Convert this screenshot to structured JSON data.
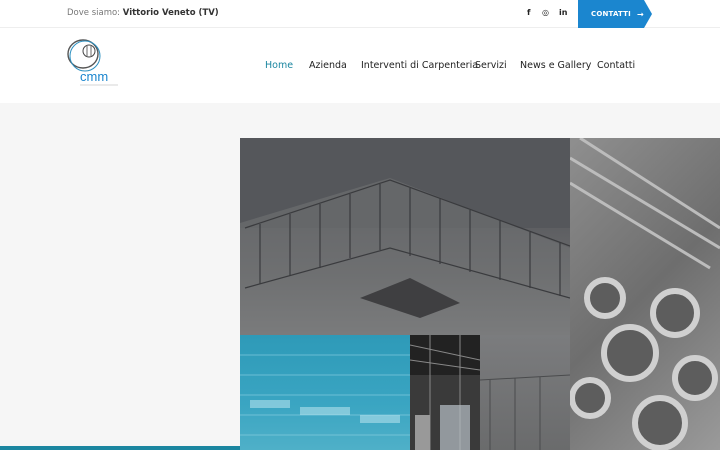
{
  "topbar": {
    "location_label": "Dove siamo:",
    "location_value": "Vittorio Veneto (TV)",
    "social": [
      "f",
      "◎",
      "in"
    ],
    "contact_label": "CONTATTI",
    "contact_arrow": "→"
  },
  "brand": {
    "logo_text": "cmm"
  },
  "nav": {
    "items": [
      "Home",
      "Azienda",
      "Interventi di Carpenteria",
      "Servizi",
      "News e Gallery",
      "Contatti"
    ],
    "active": "Home"
  },
  "colors": {
    "accent": "#1b86cf",
    "nav_active": "#1b86a0",
    "hero_bg": "#f6f6f6"
  }
}
